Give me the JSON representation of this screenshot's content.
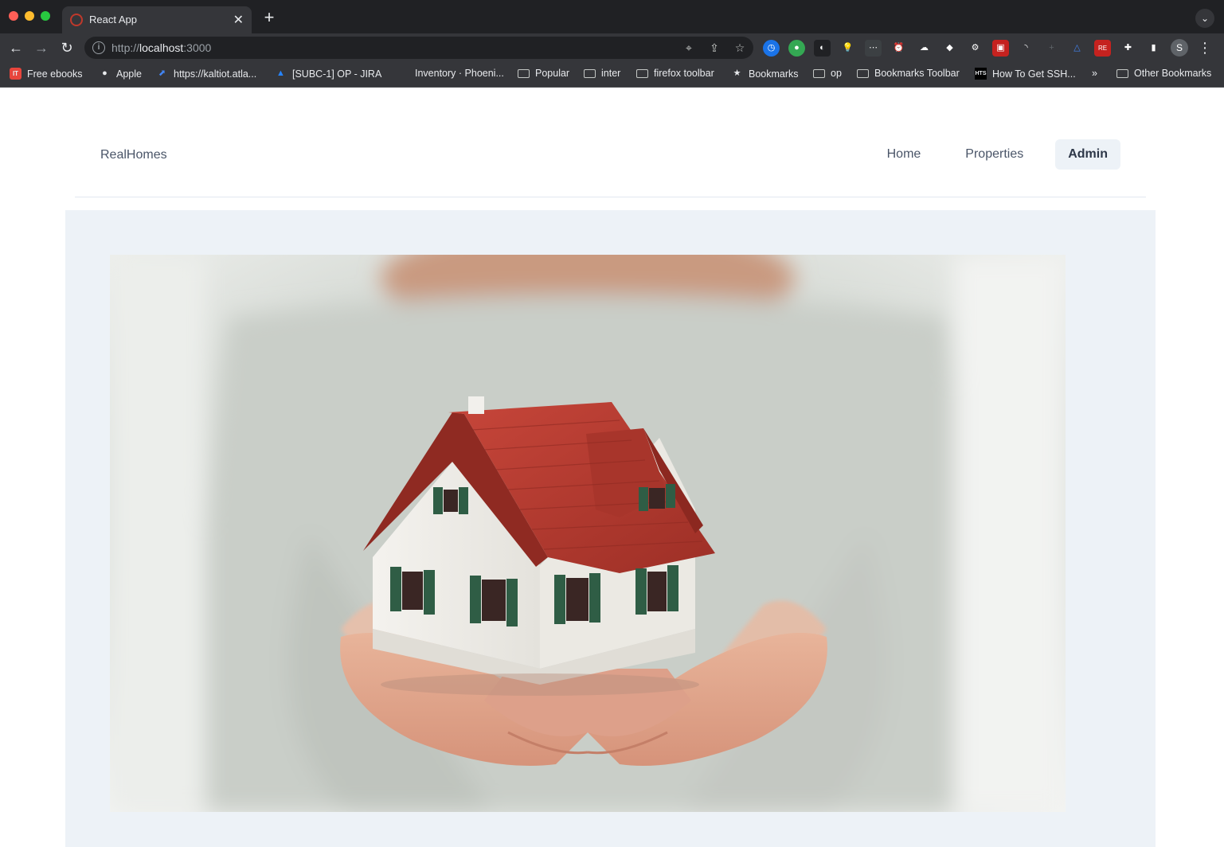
{
  "browser": {
    "tab_title": "React App",
    "url_scheme": "http://",
    "url_host": "localhost",
    "url_port": ":3000",
    "profile_initial": "S",
    "bookmarks": [
      {
        "label": "Free ebooks",
        "icon": "it-icon"
      },
      {
        "label": "Apple",
        "icon": "apple-icon"
      },
      {
        "label": "https://kaltiot.atla...",
        "icon": "link-icon"
      },
      {
        "label": "[SUBC-1] OP - JIRA",
        "icon": "jira-icon"
      },
      {
        "label": "Inventory · Phoeni...",
        "icon": "none"
      },
      {
        "label": "Popular",
        "icon": "folder-icon"
      },
      {
        "label": "inter",
        "icon": "folder-icon"
      },
      {
        "label": "firefox toolbar",
        "icon": "folder-icon"
      },
      {
        "label": "Bookmarks",
        "icon": "star-icon"
      },
      {
        "label": "op",
        "icon": "folder-icon"
      },
      {
        "label": "Bookmarks Toolbar",
        "icon": "folder-icon"
      },
      {
        "label": "How To Get SSH...",
        "icon": "hts-icon"
      },
      {
        "label": "»",
        "icon": "none"
      },
      {
        "label": "Other Bookmarks",
        "icon": "folder-icon"
      }
    ]
  },
  "app": {
    "brand": "RealHomes",
    "nav": {
      "home": "Home",
      "properties": "Properties",
      "admin": "Admin"
    },
    "active_nav": "admin",
    "hero_image": "house-in-hands-photo"
  },
  "colors": {
    "hero_bg": "#edf2f7",
    "roof": "#b83a2f",
    "shutters": "#2f5d45",
    "text": "#4a5568"
  }
}
